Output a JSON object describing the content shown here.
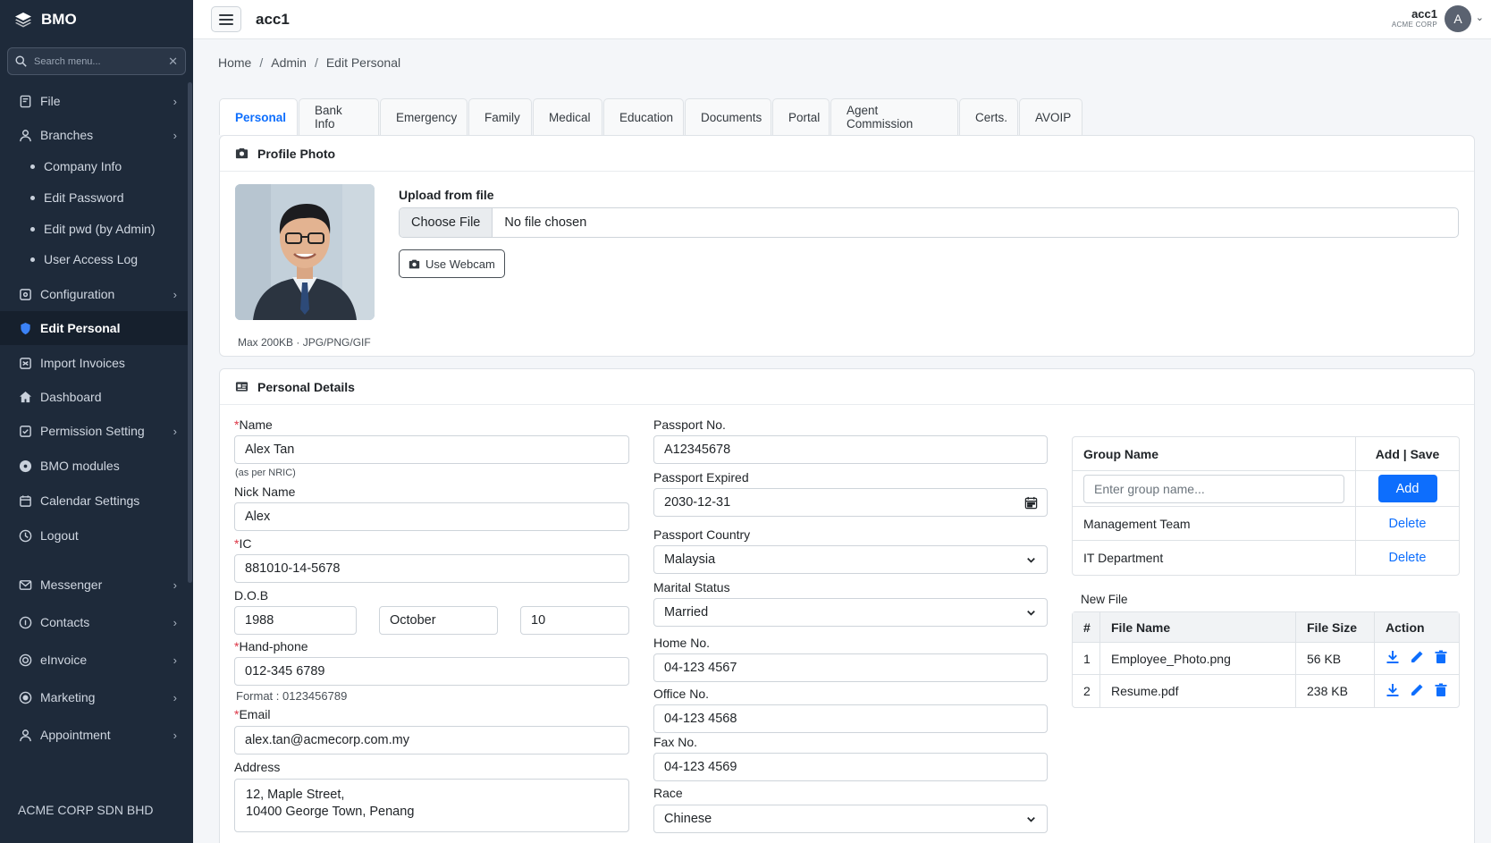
{
  "sidebar": {
    "brand": "BMO",
    "search_placeholder": "Search menu...",
    "items": [
      {
        "label": "File",
        "icon": "file-icon"
      },
      {
        "label": "Branches",
        "icon": "user-icon"
      },
      {
        "label": "Company Info"
      },
      {
        "label": "Edit Password"
      },
      {
        "label": "Edit pwd (by Admin)"
      },
      {
        "label": "User Access Log"
      },
      {
        "label": "Configuration",
        "icon": "config-icon"
      },
      {
        "label": "Edit Personal",
        "icon": "user-shield-icon"
      },
      {
        "label": "Import Invoices",
        "icon": "import-icon"
      },
      {
        "label": "Dashboard",
        "icon": "dashboard-icon"
      },
      {
        "label": "Permission Setting",
        "icon": "permission-icon"
      },
      {
        "label": "BMO modules",
        "icon": "modules-icon"
      },
      {
        "label": "Calendar Settings",
        "icon": "calendar-icon"
      },
      {
        "label": "Logout",
        "icon": "logout-icon"
      },
      {
        "label": "Messenger",
        "icon": "mail-icon"
      },
      {
        "label": "Contacts",
        "icon": "contacts-icon"
      },
      {
        "label": "eInvoice",
        "icon": "einvoice-icon"
      },
      {
        "label": "Marketing",
        "icon": "marketing-icon"
      },
      {
        "label": "Appointment",
        "icon": "appointment-icon"
      }
    ],
    "footer": "ACME CORP SDN BHD"
  },
  "topbar": {
    "title": "acc1",
    "user_name": "acc1",
    "user_company": "ACME CORP",
    "avatar_letter": "A"
  },
  "breadcrumb": {
    "home": "Home",
    "admin": "Admin",
    "current": "Edit Personal"
  },
  "tabs": [
    "Personal",
    "Bank Info",
    "Emergency",
    "Family",
    "Medical",
    "Education",
    "Documents",
    "Portal",
    "Agent Commission",
    "Certs.",
    "AVOIP"
  ],
  "profile": {
    "header": "Profile Photo",
    "caption": "Max 200KB · JPG/PNG/GIF",
    "upload_label": "Upload from file",
    "choose_file": "Choose File",
    "no_file": "No file chosen",
    "webcam": "Use Webcam"
  },
  "details": {
    "header": "Personal Details",
    "name_label": "Name",
    "name_value": "Alex Tan",
    "name_hint": "(as per NRIC)",
    "nick_label": "Nick Name",
    "nick_value": "Alex",
    "ic_label": "IC",
    "ic_value": "881010-14-5678",
    "dob_label": "D.O.B",
    "dob_year": "1988",
    "dob_month": "October",
    "dob_day": "10",
    "phone_label": "Hand-phone",
    "phone_value": "012-345 6789",
    "phone_hint": "Format : 0123456789",
    "email_label": "Email",
    "email_value": "alex.tan@acmecorp.com.my",
    "address_label": "Address",
    "address_line1": "12, Maple Street,",
    "address_line2": "10400 George Town, Penang",
    "passport_label": "Passport No.",
    "passport_value": "A12345678",
    "passport_exp_label": "Passport Expired",
    "passport_exp_value": "2030-12-31",
    "passport_country_label": "Passport Country",
    "passport_country_value": "Malaysia",
    "marital_label": "Marital Status",
    "marital_value": "Married",
    "home_label": "Home No.",
    "home_value": "04-123 4567",
    "office_label": "Office No.",
    "office_value": "04-123 4568",
    "fax_label": "Fax No.",
    "fax_value": "04-123 4569",
    "race_label": "Race",
    "race_value": "Chinese"
  },
  "groups": {
    "col_name": "Group Name",
    "col_action": "Add | Save",
    "input_placeholder": "Enter group name...",
    "add_label": "Add",
    "rows": [
      {
        "name": "Management Team",
        "action": "Delete"
      },
      {
        "name": "IT Department",
        "action": "Delete"
      }
    ]
  },
  "files": {
    "label": "New File",
    "headers": [
      "#",
      "File Name",
      "File Size",
      "Action"
    ],
    "rows": [
      {
        "no": "1",
        "name": "Employee_Photo.png",
        "size": "56 KB"
      },
      {
        "no": "2",
        "name": "Resume.pdf",
        "size": "238 KB"
      }
    ]
  },
  "colors": {
    "accent": "#0d6efd",
    "sidebar": "#1e2a3a",
    "required": "#dc3545"
  }
}
